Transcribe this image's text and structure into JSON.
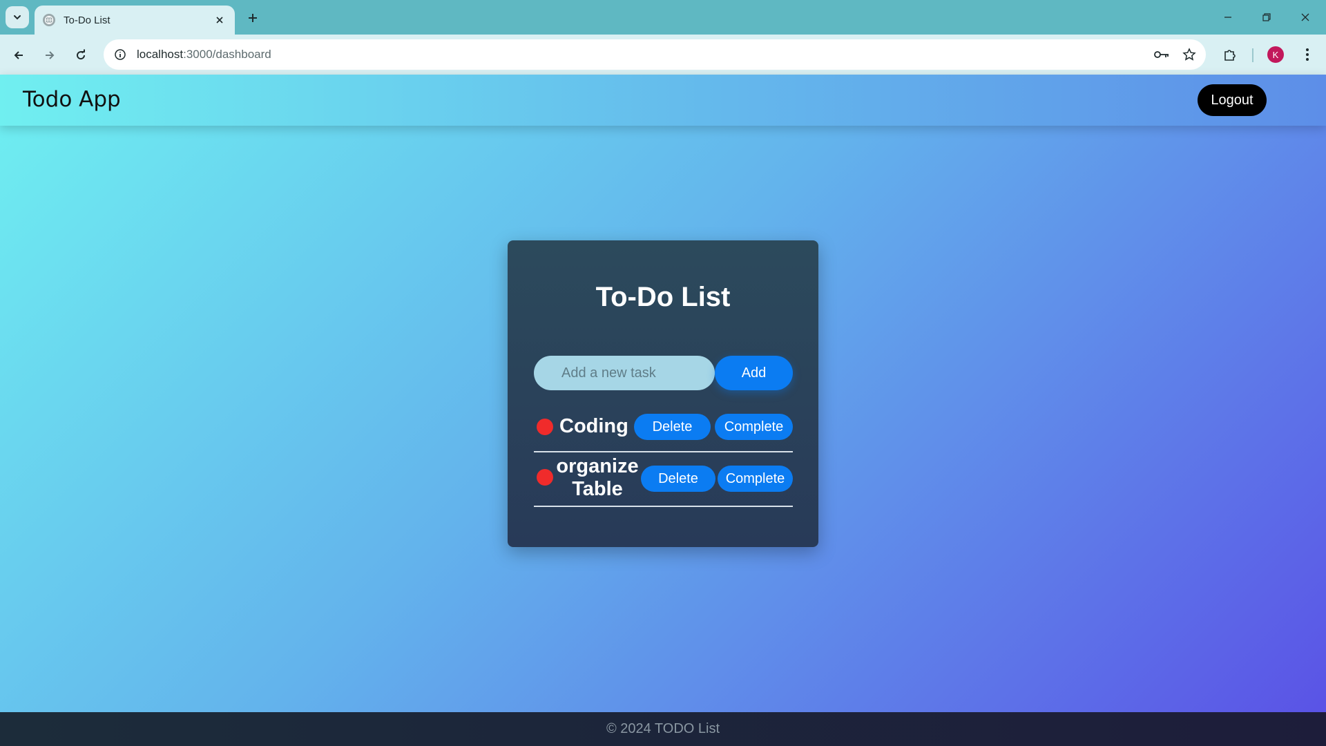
{
  "browser": {
    "tab_title": "To-Do List",
    "url_host": "localhost",
    "url_path": ":3000/dashboard",
    "profile_initial": "K"
  },
  "app": {
    "brand": "Todo App",
    "logout_label": "Logout"
  },
  "todo": {
    "title": "To-Do List",
    "input_placeholder": "Add a new task",
    "add_label": "Add",
    "tasks": [
      {
        "text": "Coding",
        "delete_label": "Delete",
        "complete_label": "Complete"
      },
      {
        "text": "organize Table",
        "delete_label": "Delete",
        "complete_label": "Complete"
      }
    ]
  },
  "footer": {
    "text": "© 2024 TODO List"
  },
  "colors": {
    "accent": "#0b7cf2",
    "status_dot": "#f02b2b",
    "card_bg": "#2c4a5c",
    "logout_bg": "#000000"
  }
}
